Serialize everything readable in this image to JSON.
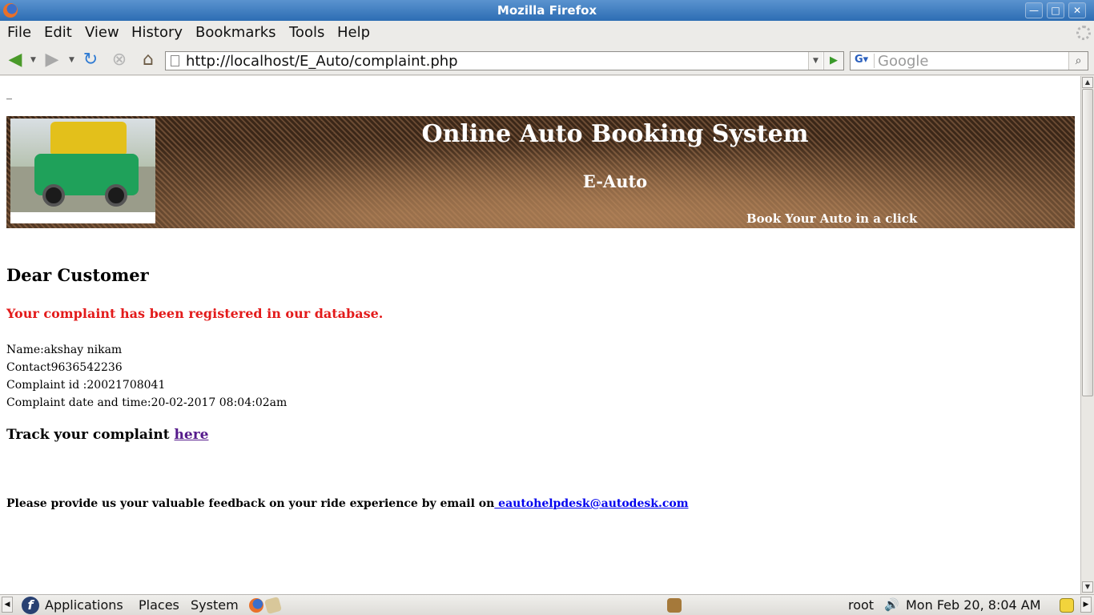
{
  "window": {
    "title": "Mozilla Firefox"
  },
  "menubar": {
    "items": [
      "File",
      "Edit",
      "View",
      "History",
      "Bookmarks",
      "Tools",
      "Help"
    ]
  },
  "navbar": {
    "url": "http://localhost/E_Auto/complaint.php",
    "search_placeholder": "Google"
  },
  "page": {
    "cursor_mark": "_",
    "banner": {
      "title": "Online Auto Booking System",
      "subtitle": "E-Auto",
      "tagline": "Book Your Auto in a click"
    },
    "greeting": "Dear Customer",
    "notice": "Your complaint has been registered in our database.",
    "details": {
      "name": "Name:akshay nikam",
      "contact": "Contact9636542236",
      "complaint_id": "Complaint id :20021708041",
      "date_time": "Complaint date and time:20-02-2017 08:04:02am"
    },
    "track_text": "Track your complaint",
    "track_link": "here",
    "feedback_text": "Please provide us your valuable feedback on your ride experience by email on",
    "feedback_email": " eautohelpdesk@autodesk.com"
  },
  "panel": {
    "applications": "Applications",
    "places": "Places",
    "system": "System",
    "user": "root",
    "clock": "Mon Feb 20,  8:04 AM"
  }
}
